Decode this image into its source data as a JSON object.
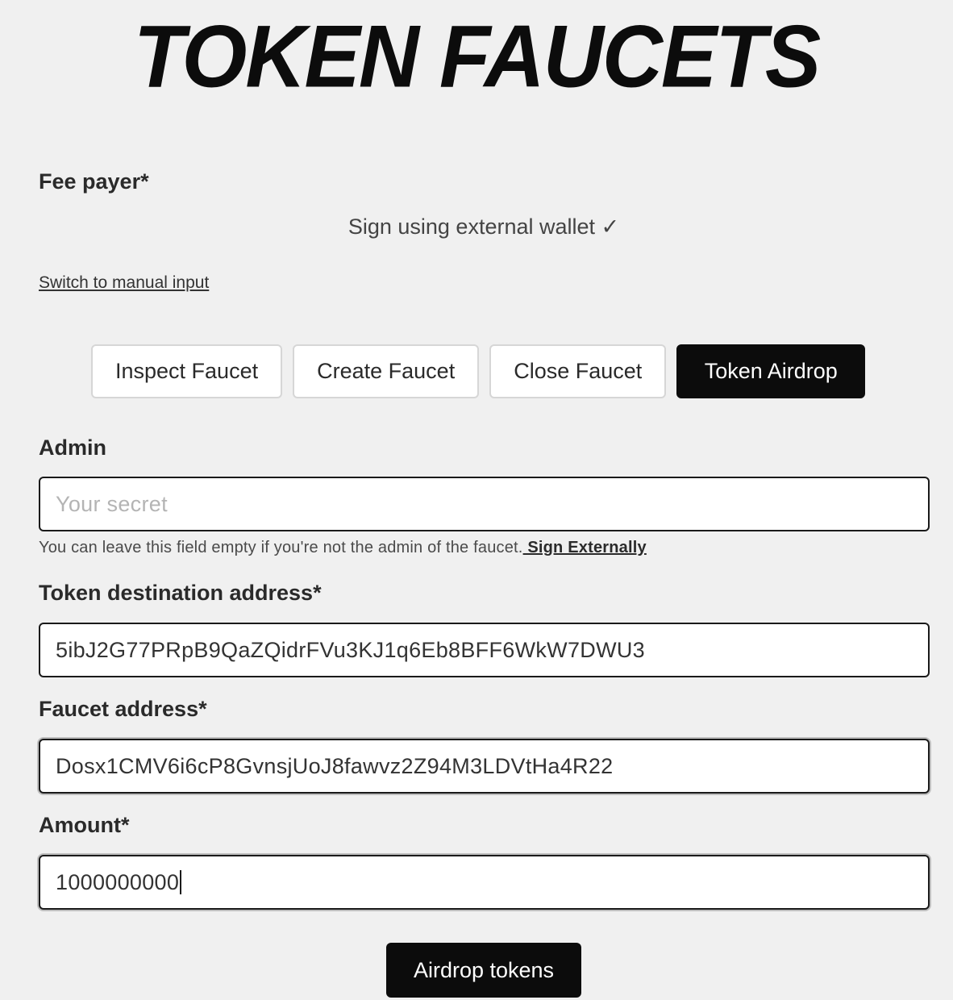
{
  "header": {
    "title": "TOKEN FAUCETS"
  },
  "fee_payer": {
    "label": "Fee payer*",
    "status": "Sign using external wallet ✓",
    "switch_link": "Switch to manual input"
  },
  "tabs": [
    {
      "label": "Inspect Faucet",
      "active": false
    },
    {
      "label": "Create Faucet",
      "active": false
    },
    {
      "label": "Close Faucet",
      "active": false
    },
    {
      "label": "Token Airdrop",
      "active": true
    }
  ],
  "form": {
    "admin": {
      "label": "Admin",
      "placeholder": "Your secret",
      "value": "",
      "hint": "You can leave this field empty if you're not the admin of the faucet.",
      "hint_link": " Sign Externally"
    },
    "destination": {
      "label": "Token destination address*",
      "value": "5ibJ2G77PRpB9QaZQidrFVu3KJ1q6Eb8BFF6WkW7DWU3"
    },
    "faucet": {
      "label": "Faucet address*",
      "value": "Dosx1CMV6i6cP8GvnsjUoJ8fawvz2Z94M3LDVtHa4R22"
    },
    "amount": {
      "label": "Amount*",
      "value": "1000000000"
    },
    "submit_label": "Airdrop tokens"
  },
  "colors": {
    "background": "#f0f0f0",
    "primary": "#0c0c0c",
    "text": "#2a2a2a",
    "placeholder": "#b4b4b4"
  }
}
